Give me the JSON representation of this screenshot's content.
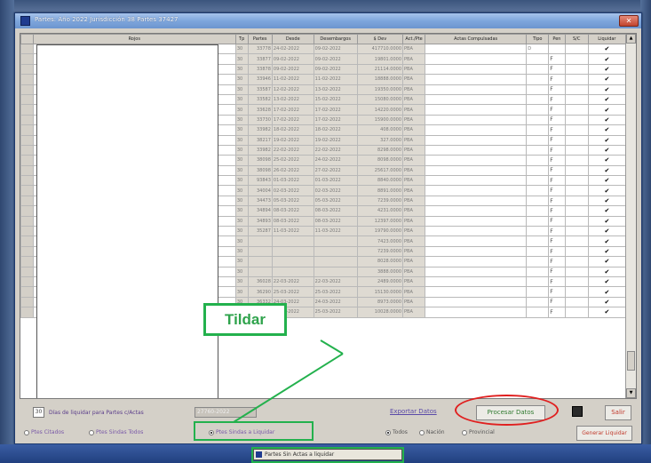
{
  "window": {
    "title": "Partes: Año 2022 Jurisdicción 38 Partes 37427",
    "close_label": "✕"
  },
  "grid": {
    "columns": [
      "Rojos",
      "Tp",
      "Partes",
      "Desde",
      "Desembargos",
      "$ Dev",
      "Act./Pte",
      "Actas Compulsadas",
      "Tipo",
      "Pen",
      "S/C",
      "Liquidar"
    ],
    "rows": [
      [
        "30",
        "33778",
        "24-02-2022",
        "09-02-2022",
        "417710.0000",
        "PBA",
        "",
        "D",
        "",
        "✔"
      ],
      [
        "30",
        "33877",
        "09-02-2022",
        "09-02-2022",
        "19801.0000",
        "PBA",
        "",
        "",
        "F",
        "✔"
      ],
      [
        "30",
        "33878",
        "09-02-2022",
        "09-02-2022",
        "21114.0000",
        "PBA",
        "",
        "",
        "F",
        "✔"
      ],
      [
        "30",
        "33946",
        "11-02-2022",
        "11-02-2022",
        "18888.0000",
        "PBA",
        "",
        "",
        "F",
        "✔"
      ],
      [
        "30",
        "33587",
        "12-02-2022",
        "13-02-2022",
        "19350.0000",
        "PBA",
        "",
        "",
        "F",
        "✔"
      ],
      [
        "30",
        "33582",
        "13-02-2022",
        "15-02-2022",
        "15080.0000",
        "PBA",
        "",
        "",
        "F",
        "✔"
      ],
      [
        "30",
        "33628",
        "17-02-2022",
        "17-02-2022",
        "14220.0000",
        "PBA",
        "",
        "",
        "F",
        "✔"
      ],
      [
        "30",
        "33730",
        "17-02-2022",
        "17-02-2022",
        "15900.0000",
        "PBA",
        "",
        "",
        "F",
        "✔"
      ],
      [
        "30",
        "33982",
        "18-02-2022",
        "18-02-2022",
        "408.0000",
        "PBA",
        "",
        "",
        "F",
        "✔"
      ],
      [
        "30",
        "38217",
        "19-02-2022",
        "19-02-2022",
        "327.0000",
        "PBA",
        "",
        "",
        "F",
        "✔"
      ],
      [
        "30",
        "33982",
        "22-02-2022",
        "22-02-2022",
        "8298.0000",
        "PBA",
        "",
        "",
        "F",
        "✔"
      ],
      [
        "30",
        "38098",
        "25-02-2022",
        "24-02-2022",
        "8098.0000",
        "PBA",
        "",
        "",
        "F",
        "✔"
      ],
      [
        "30",
        "38098",
        "26-02-2022",
        "27-02-2022",
        "25617.0000",
        "PBA",
        "",
        "",
        "F",
        "✔"
      ],
      [
        "30",
        "93843",
        "01-03-2022",
        "01-03-2022",
        "8840.0000",
        "PBA",
        "",
        "",
        "F",
        "✔"
      ],
      [
        "30",
        "34004",
        "02-03-2022",
        "02-03-2022",
        "8891.0000",
        "PBA",
        "",
        "",
        "F",
        "✔"
      ],
      [
        "30",
        "34473",
        "05-03-2022",
        "05-03-2022",
        "7239.0000",
        "PBA",
        "",
        "",
        "F",
        "✔"
      ],
      [
        "30",
        "34894",
        "08-03-2022",
        "08-03-2022",
        "4231.0000",
        "PBA",
        "",
        "",
        "F",
        "✔"
      ],
      [
        "30",
        "34893",
        "08-03-2022",
        "08-03-2022",
        "12397.0000",
        "PBA",
        "",
        "",
        "F",
        "✔"
      ],
      [
        "30",
        "35287",
        "11-03-2022",
        "11-03-2022",
        "19790.0000",
        "PBA",
        "",
        "",
        "F",
        "✔"
      ],
      [
        "30",
        "",
        "",
        "",
        "7423.0000",
        "PBA",
        "",
        "",
        "F",
        "✔"
      ],
      [
        "30",
        "",
        "",
        "",
        "7239.0000",
        "PBA",
        "",
        "",
        "F",
        "✔"
      ],
      [
        "30",
        "",
        "",
        "",
        "8028.0000",
        "PBA",
        "",
        "",
        "F",
        "✔"
      ],
      [
        "30",
        "",
        "",
        "",
        "3888.0000",
        "PBA",
        "",
        "",
        "F",
        "✔"
      ],
      [
        "30",
        "36028",
        "22-03-2022",
        "22-03-2022",
        "2489.0000",
        "PBA",
        "",
        "",
        "F",
        "✔"
      ],
      [
        "30",
        "36290",
        "25-03-2022",
        "25-03-2022",
        "15130.0000",
        "PBA",
        "",
        "",
        "F",
        "✔"
      ],
      [
        "30",
        "36332",
        "24-03-2022",
        "24-03-2022",
        "8973.0000",
        "PBA",
        "",
        "",
        "F",
        "✔"
      ],
      [
        "30",
        "36330",
        "25-03-2022",
        "25-03-2022",
        "10028.0000",
        "PBA",
        "",
        "",
        "F",
        "✔"
      ]
    ]
  },
  "footer": {
    "dias_value": "30",
    "dias_label": "Días de liquidar para Partes c/Actas",
    "cuit_field": "27760-2022",
    "exportar": "Exportar Datos",
    "procesar": "Procesar Datos",
    "salir": "Salir",
    "generar": "Generar Liquidar",
    "options": [
      "Ptes Citados",
      "Ptes Sindas Todos",
      "Ptes Sindas a Liquidar"
    ],
    "options2": [
      "Todos",
      "Nación",
      "Provincial"
    ]
  },
  "annotations": {
    "callout": "Tildar"
  },
  "taskbar": {
    "item": "Partes Sin Actas a liquidar"
  }
}
